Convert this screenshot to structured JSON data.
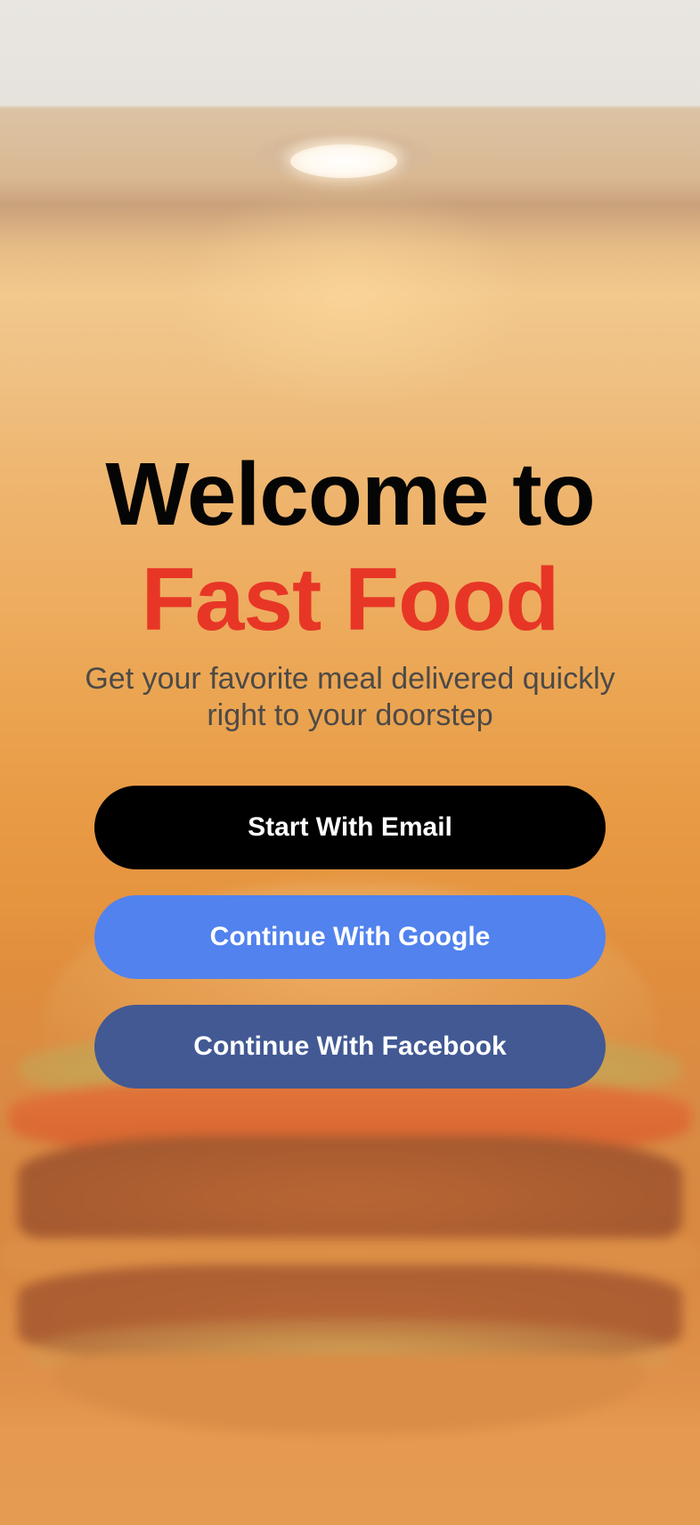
{
  "welcome": {
    "line1": "Welcome to",
    "line2": "Fast Food",
    "subtitle": "Get your favorite meal delivered quickly right to your doorstep"
  },
  "buttons": {
    "email_label": "Start With Email",
    "google_label": "Continue With Google",
    "facebook_label": "Continue With Facebook"
  },
  "colors": {
    "accent_red": "#e73626",
    "email_button": "#000000",
    "google_button": "#5182ed",
    "facebook_button": "#425994"
  }
}
